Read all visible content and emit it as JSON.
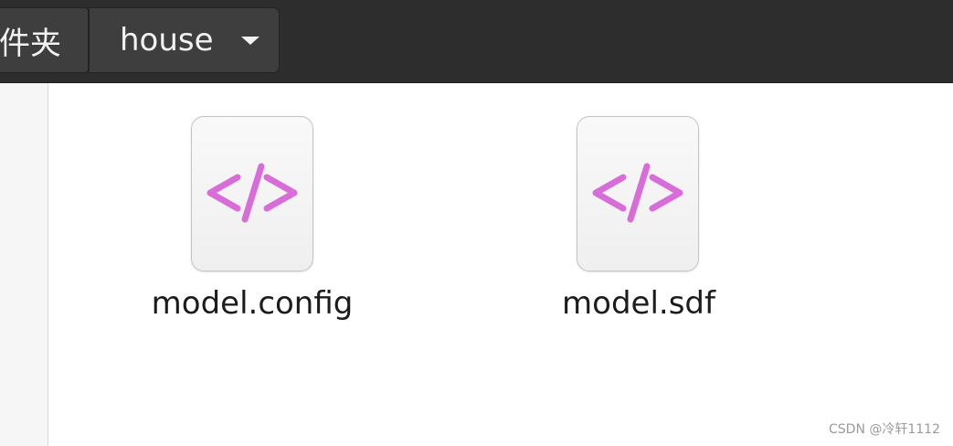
{
  "header": {
    "breadcrumbs": [
      {
        "label": "件夹"
      },
      {
        "label": "house"
      }
    ]
  },
  "files": [
    {
      "name": "model.config",
      "icon": "code-file-icon"
    },
    {
      "name": "model.sdf",
      "icon": "code-file-icon"
    }
  ],
  "icon_color": "#d86cd8",
  "watermark": "CSDN @冷轩1112"
}
